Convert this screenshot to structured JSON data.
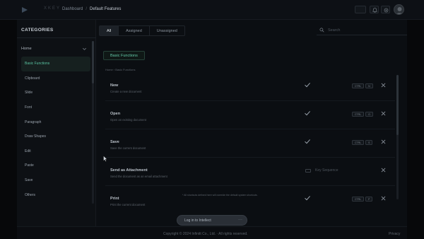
{
  "header": {
    "brand": "XKEY",
    "breadcrumb_root": "Dashboard",
    "breadcrumb_sep": "/",
    "breadcrumb_current": "Default Features"
  },
  "sidebar": {
    "title": "CATEGORIES",
    "home_label": "Home",
    "items": [
      {
        "label": "Basic Functions",
        "active": true
      },
      {
        "label": "Clipboard"
      },
      {
        "label": "Slide"
      },
      {
        "label": "Font"
      },
      {
        "label": "Paragraph"
      },
      {
        "label": "Draw Shapes"
      },
      {
        "label": "Edit"
      },
      {
        "label": "Paste"
      },
      {
        "label": "Save"
      },
      {
        "label": "Others"
      }
    ]
  },
  "main": {
    "tabs": [
      {
        "label": "All",
        "active": true
      },
      {
        "label": "Assigned"
      },
      {
        "label": "Unassigned"
      }
    ],
    "search_placeholder": "Search",
    "section_label": "Basic Functions",
    "sub_breadcrumb": "Home › Basic Functions",
    "rows": [
      {
        "title": "New",
        "desc": "Create a new document",
        "assigned": true,
        "keys": [
          "CTRL",
          "N"
        ]
      },
      {
        "title": "Open",
        "desc": "Open an existing document",
        "assigned": true,
        "keys": [
          "CTRL",
          "O"
        ]
      },
      {
        "title": "Save",
        "desc": "Save the current document",
        "assigned": true,
        "keys": [
          "CTRL",
          "S"
        ]
      },
      {
        "title": "Send as Attachment",
        "desc": "Send the document as an email attachment",
        "assigned": false,
        "key_placeholder": "Key Sequence"
      },
      {
        "title": "Print",
        "desc": "Print the current document",
        "assigned": true,
        "keys": [
          "CTRL",
          "P"
        ]
      }
    ],
    "note": "* All shortcuts defined here will override the default system shortcuts.",
    "login_label": "Log in to Intellect",
    "login_more": "···"
  },
  "footer": {
    "copyright": "Copyright © 2024 Infinitt Co., Ltd. · All rights reserved.",
    "privacy": "Privacy"
  },
  "colors": {
    "accent": "#5ec3a2",
    "background": "#0b0d11",
    "panel": "#0d1014"
  }
}
